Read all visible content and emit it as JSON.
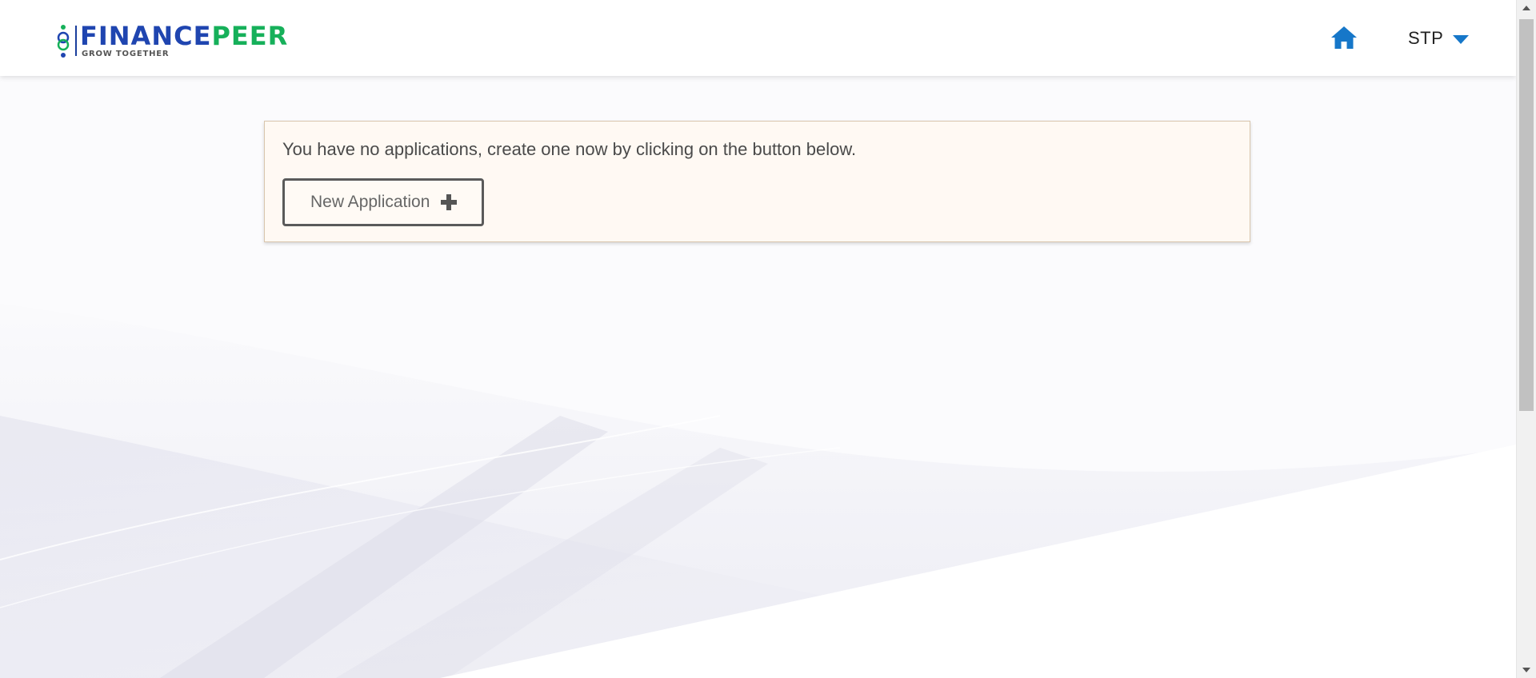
{
  "header": {
    "logo": {
      "word_part1": "FINANCE",
      "word_part2": "PEER",
      "tagline": "GROW TOGETHER",
      "color_primary": "#1f45b0",
      "color_secondary": "#16b05a"
    },
    "home_icon": "home-icon",
    "home_icon_color": "#1677c9",
    "user_menu": {
      "label": "STP",
      "caret_icon": "caret-down-icon"
    }
  },
  "notice": {
    "message": "You have no applications, create one now by clicking on the button below.",
    "button_label": "New Application",
    "button_icon": "plus-icon"
  }
}
